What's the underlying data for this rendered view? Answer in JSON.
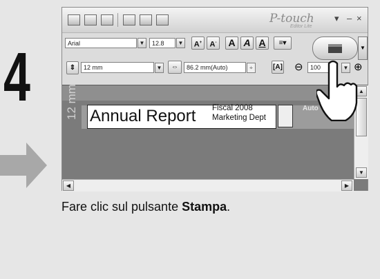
{
  "step": {
    "number": "4"
  },
  "window": {
    "brand": "P-touch",
    "brand_sub": "Editor Lite",
    "controls": {
      "menu": "▾",
      "minimize": "–",
      "close": "×"
    }
  },
  "toolbar": {
    "font_name": "Arial",
    "font_size": "12.8",
    "tape_width": "12 mm",
    "label_length": "86.2 mm(Auto)",
    "zoom": "100"
  },
  "canvas": {
    "ruler_label": "12 mm",
    "label_main": "Annual Report",
    "label_line1": "Fiscal 2008",
    "label_line2": "Marketing Dept",
    "auto_text": "Auto"
  },
  "instruction": {
    "prefix": "Fare clic sul pulsante ",
    "emphasis": "Stampa",
    "suffix": "."
  }
}
